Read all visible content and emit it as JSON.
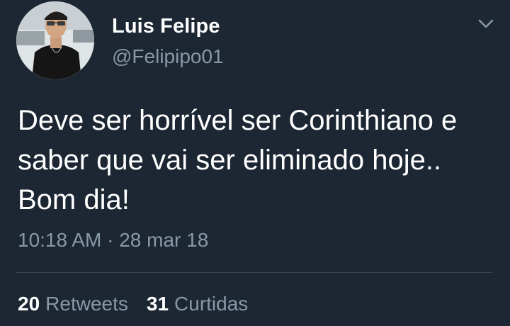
{
  "tweet": {
    "author_name": "Luis Felipe",
    "handle": "@Felipipo01",
    "text": "Deve ser horrível ser Corinthiano e\nsaber que vai ser eliminado hoje..\nBom dia!",
    "time": "10:18 AM",
    "separator": "·",
    "date": "28 mar 18",
    "menu_icon": "chevron-down-icon"
  },
  "stats": {
    "retweets_count": "20",
    "retweets_label": "Retweets",
    "likes_count": "31",
    "likes_label": "Curtidas"
  },
  "colors": {
    "background": "#1c2733",
    "primary_text": "#ffffff",
    "secondary_text": "#8899a6",
    "divider": "#38444d"
  }
}
